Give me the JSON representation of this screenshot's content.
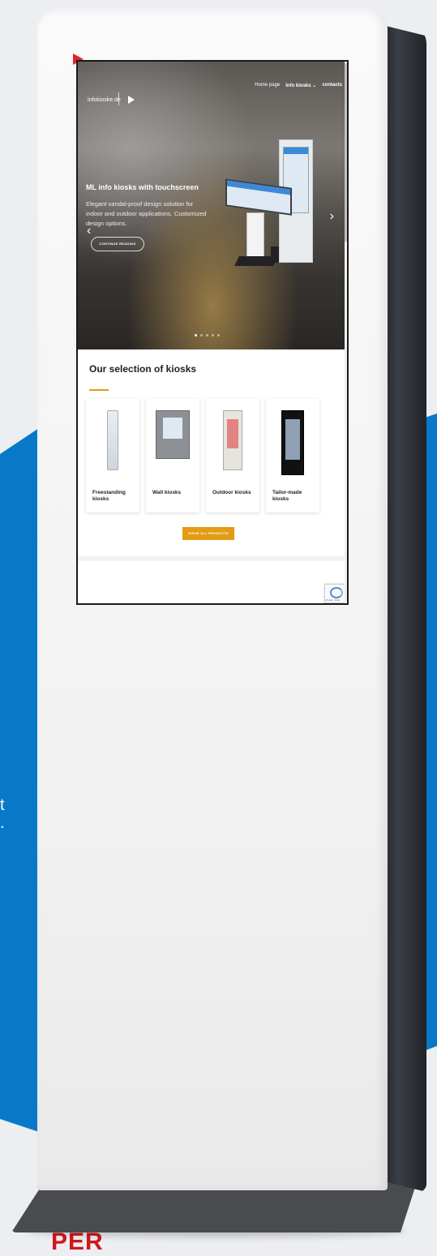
{
  "background": {
    "text_line_1": "t",
    "text_line_2": ".",
    "brand_text": "PER"
  },
  "website": {
    "site_name": "infokioske.de",
    "nav": [
      "Home page",
      "Info kiosks ⌄",
      "contacts"
    ],
    "hero": {
      "title": "ML info kiosks with touchscreen",
      "text": "Elegant vandal-proof design solution for indoor and outdoor applications. Customized design options.",
      "button": "CONTINUE READING"
    },
    "section_title": "Our selection of kiosks",
    "cards": [
      {
        "label": "Freestanding kiosks"
      },
      {
        "label": "Wall kiosks"
      },
      {
        "label": "Outdoor kiosks"
      },
      {
        "label": "Tailor-made kiosks"
      }
    ],
    "show_all_button": "SHOW ALL PRODUCTS",
    "recaptcha_text": "Privacy - Terms"
  },
  "colors": {
    "accent": "#e39c14",
    "brand_red": "#d0171b",
    "blue": "#0a78c9"
  }
}
